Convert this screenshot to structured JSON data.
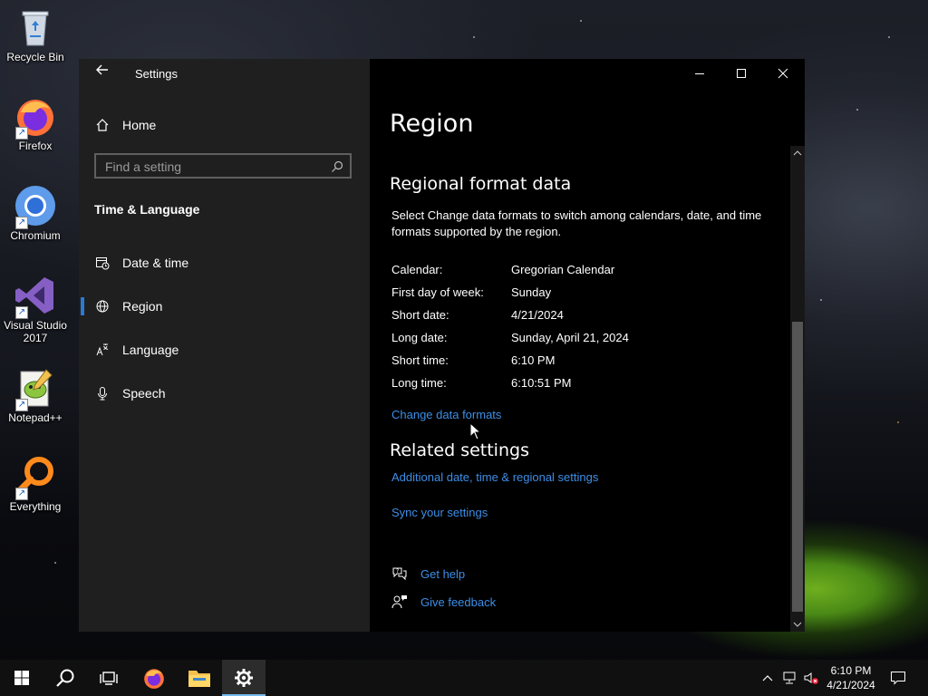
{
  "desktop": {
    "icons": [
      {
        "label": "Recycle Bin",
        "icon": "recycle-bin-icon"
      },
      {
        "label": "Firefox",
        "icon": "firefox-icon"
      },
      {
        "label": "Chromium",
        "icon": "chromium-icon"
      },
      {
        "label": "Visual Studio 2017",
        "icon": "visual-studio-icon"
      },
      {
        "label": "Notepad++",
        "icon": "notepad-plus-plus-icon"
      },
      {
        "label": "Everything",
        "icon": "everything-search-icon"
      }
    ]
  },
  "window": {
    "title": "Settings",
    "controls": {
      "minimize": "minimize-icon",
      "maximize": "maximize-icon",
      "close": "close-icon"
    }
  },
  "sidebar": {
    "home_label": "Home",
    "search_placeholder": "Find a setting",
    "section_header": "Time & Language",
    "items": [
      {
        "label": "Date & time",
        "icon": "calendar-clock-icon",
        "selected": false
      },
      {
        "label": "Region",
        "icon": "globe-icon",
        "selected": true
      },
      {
        "label": "Language",
        "icon": "language-icon",
        "selected": false
      },
      {
        "label": "Speech",
        "icon": "microphone-icon",
        "selected": false
      }
    ]
  },
  "content": {
    "page_title": "Region",
    "regional_format": {
      "heading": "Regional format data",
      "description": "Select Change data formats to switch among calendars, date, and time formats supported by the region.",
      "rows": [
        {
          "key": "Calendar:",
          "value": "Gregorian Calendar"
        },
        {
          "key": "First day of week:",
          "value": "Sunday"
        },
        {
          "key": "Short date:",
          "value": "4/21/2024"
        },
        {
          "key": "Long date:",
          "value": "Sunday, April 21, 2024"
        },
        {
          "key": "Short time:",
          "value": "6:10 PM"
        },
        {
          "key": "Long time:",
          "value": "6:10:51 PM"
        }
      ],
      "change_link": "Change data formats"
    },
    "related": {
      "heading": "Related settings",
      "links": [
        "Additional date, time & regional settings",
        "Sync your settings"
      ]
    },
    "help": [
      {
        "label": "Get help",
        "icon": "help-chat-icon"
      },
      {
        "label": "Give feedback",
        "icon": "feedback-icon"
      }
    ]
  },
  "taskbar": {
    "buttons": [
      "start-icon",
      "search-icon",
      "task-view-icon",
      "firefox-icon",
      "file-explorer-icon",
      "settings-gear-icon"
    ],
    "active": "settings-gear-icon",
    "tray": [
      "chevron-up-icon",
      "network-icon",
      "volume-muted-icon",
      "action-center-icon"
    ],
    "clock": {
      "time": "6:10 PM",
      "date": "4/21/2024"
    }
  },
  "colors": {
    "accent": "#2a7ad4",
    "link": "#3d8ee6",
    "sidebar_bg": "#1f1f1f",
    "content_bg": "#000000"
  }
}
